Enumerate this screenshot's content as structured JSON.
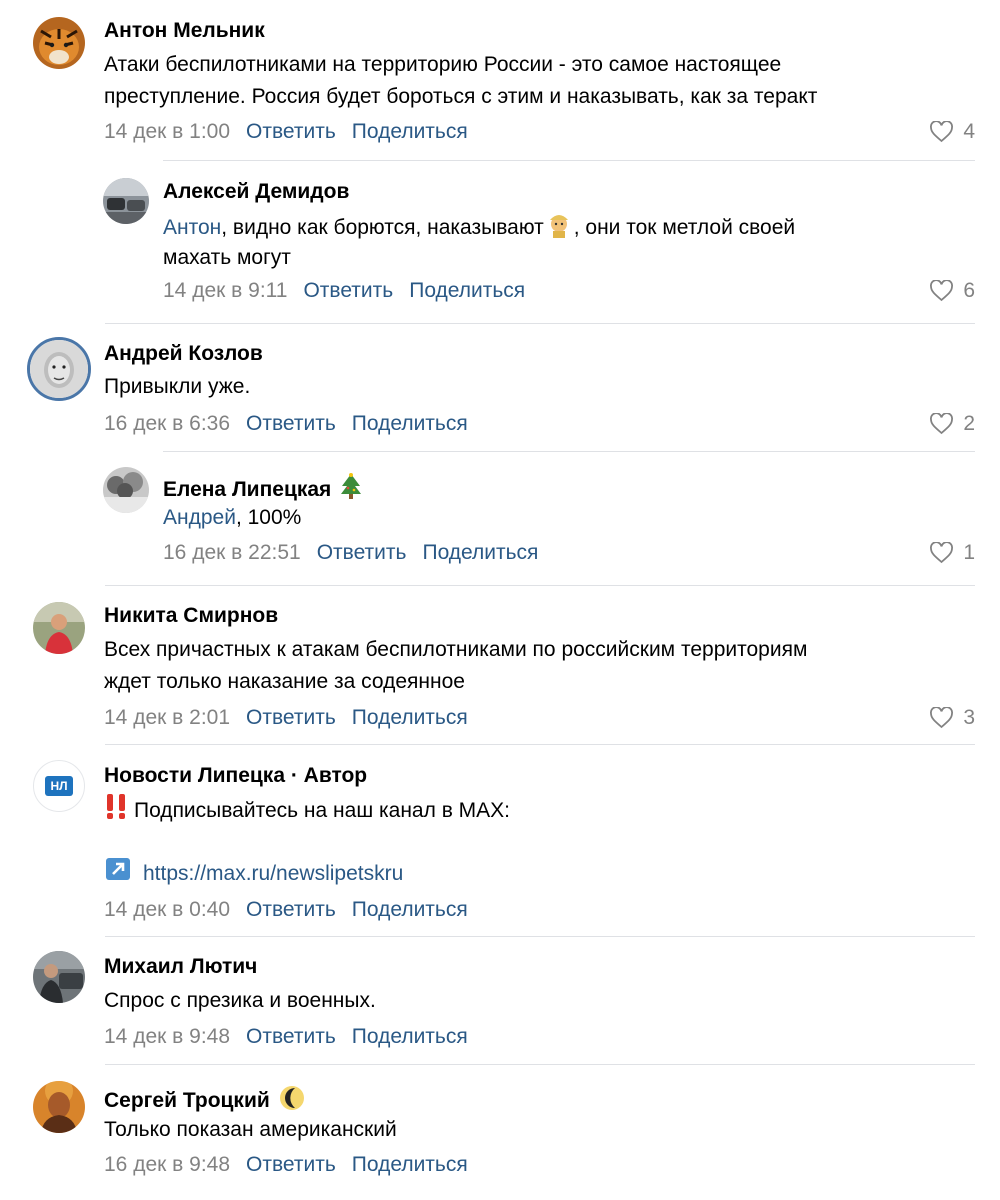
{
  "comments": [
    {
      "author": "Антон Мельник",
      "lines": [
        "Атаки беспилотниками на территорию России - это самое настоящее",
        "преступление. Россия будет бороться с этим и наказывать, как за теракт"
      ],
      "date": "14 дек в 1:00",
      "likes": "4",
      "avatar_icon": "tiger-photo"
    },
    {
      "author": "Алексей Демидов",
      "mention": "Антон",
      "lines": [
        ", видно как борются, наказывают",
        ", они ток метлой своей",
        "махать могут"
      ],
      "emoji_icon": "police-officer-emoji",
      "date": "14 дек в 9:11",
      "likes": "6",
      "avatar_icon": "cars-photo"
    },
    {
      "author": "Андрей Козлов",
      "lines": [
        "Привыкли уже."
      ],
      "date": "16 дек в 6:36",
      "likes": "2",
      "avatar_icon": "man-face-photo"
    },
    {
      "author": "Елена Липецкая",
      "author_emoji": "christmas-tree-emoji",
      "mention": "Андрей",
      "lines": [
        ", 100%"
      ],
      "date": "16 дек в 22:51",
      "likes": "1",
      "avatar_icon": "winter-trees-photo"
    },
    {
      "author": "Никита Смирнов",
      "lines": [
        "Всех причастных к атакам беспилотниками по российским территориям",
        "ждет только наказание за содеянное"
      ],
      "date": "14 дек в 2:01",
      "likes": "3",
      "avatar_icon": "person-photo"
    },
    {
      "author": "Новости Липецка · Автор",
      "avatar_text": "НЛ",
      "lines": [
        "Подписывайтесь на наш канал в MAX:"
      ],
      "lead_emoji": "double-exclamation-emoji",
      "link": "https://max.ru/newslipetskru",
      "link_icon": "arrow-up-right-icon",
      "date": "14 дек в 0:40",
      "likes": ""
    },
    {
      "author": "Михаил Лютич",
      "lines": [
        "Спрос с презика и военных."
      ],
      "date": "14 дек в 9:48",
      "likes": "",
      "avatar_icon": "person-car-photo"
    },
    {
      "author": "Сергей Троцкий",
      "author_emoji": "crescent-moon-emoji",
      "lines": [
        "Только показан американский"
      ],
      "date": "16 дек в 9:48",
      "likes": "",
      "avatar_icon": "bald-man-photo"
    }
  ],
  "actions": {
    "reply": "Ответить",
    "share": "Поделиться"
  },
  "colors": {
    "link": "#2a5885",
    "meta": "#828282",
    "divider": "#dfe1e5"
  }
}
